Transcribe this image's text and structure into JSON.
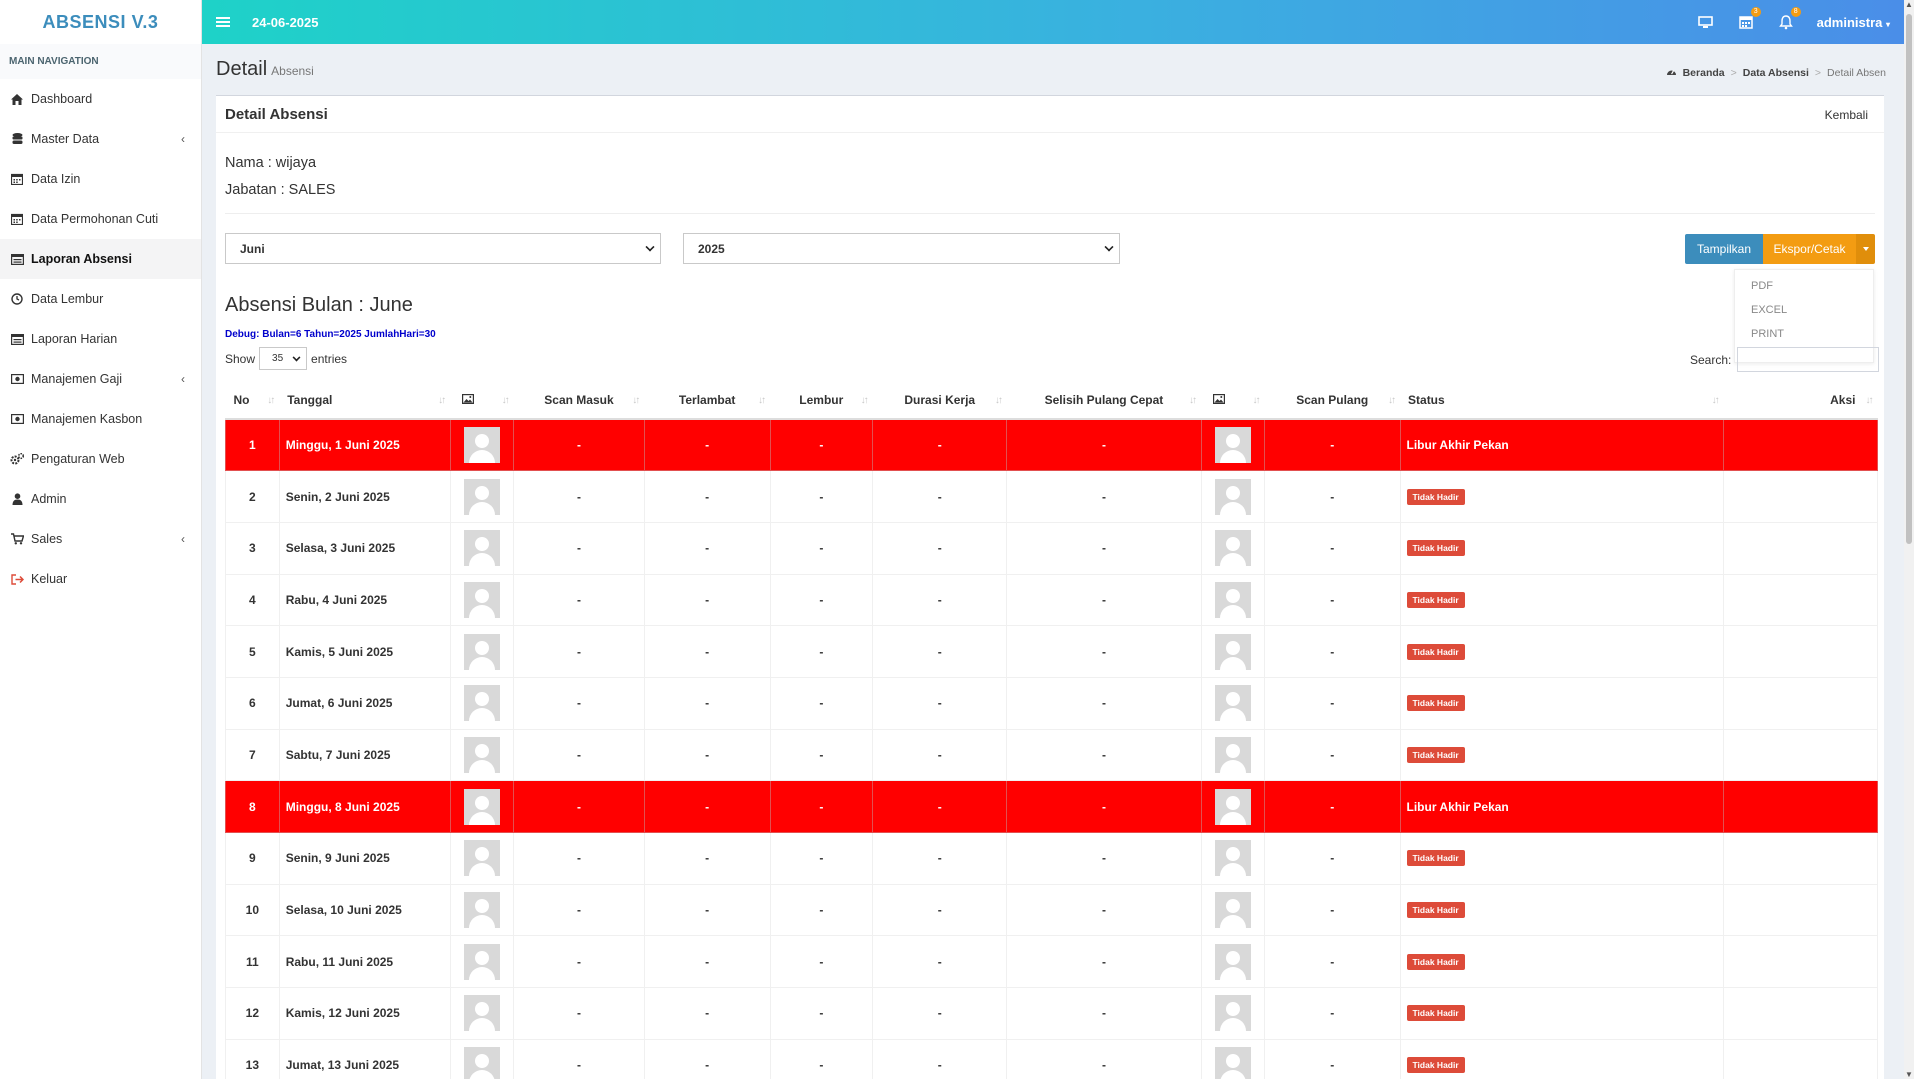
{
  "app": {
    "logo": "ABSENSI V.3"
  },
  "topbar": {
    "date": "24-06-2025",
    "user": "administra",
    "calendar_badge": "3",
    "bell_badge": "8"
  },
  "sidebar": {
    "header": "MAIN NAVIGATION",
    "items": [
      {
        "label": "Dashboard",
        "icon": "home-icon",
        "chevron": false,
        "active": false
      },
      {
        "label": "Master Data",
        "icon": "database-icon",
        "chevron": true,
        "active": false
      },
      {
        "label": "Data Izin",
        "icon": "calendar-icon",
        "chevron": false,
        "active": false
      },
      {
        "label": "Data Permohonan Cuti",
        "icon": "calendar-icon",
        "chevron": false,
        "active": false
      },
      {
        "label": "Laporan Absensi",
        "icon": "report-icon",
        "chevron": false,
        "active": true
      },
      {
        "label": "Data Lembur",
        "icon": "clock-icon",
        "chevron": false,
        "active": false
      },
      {
        "label": "Laporan Harian",
        "icon": "report-icon",
        "chevron": false,
        "active": false
      },
      {
        "label": "Manajemen Gaji",
        "icon": "money-icon",
        "chevron": true,
        "active": false
      },
      {
        "label": "Manajemen Kasbon",
        "icon": "money-icon",
        "chevron": false,
        "active": false
      },
      {
        "label": "Pengaturan Web",
        "icon": "cogs-icon",
        "chevron": false,
        "active": false
      },
      {
        "label": "Admin",
        "icon": "user-icon",
        "chevron": false,
        "active": false
      },
      {
        "label": "Sales",
        "icon": "cart-icon",
        "chevron": true,
        "active": false
      },
      {
        "label": "Keluar",
        "icon": "sign-out-icon",
        "chevron": false,
        "active": false
      }
    ]
  },
  "page": {
    "title": "Detail",
    "subtitle": "Absensi",
    "breadcrumb": [
      "Beranda",
      "Data Absensi",
      "Detail Absen"
    ]
  },
  "box": {
    "title": "Detail Absensi",
    "back": "Kembali",
    "nama": "Nama : wijaya",
    "jabatan": "Jabatan : SALES"
  },
  "filters": {
    "month": "Juni",
    "year": "2025"
  },
  "buttons": {
    "show": "Tampilkan",
    "export": "Ekspor/Cetak"
  },
  "export_menu": [
    "PDF",
    "EXCEL",
    "PRINT"
  ],
  "section": {
    "title": "Absensi Bulan : June",
    "debug": "Debug: Bulan=6 Tahun=2025 JumlahHari=30"
  },
  "datatable": {
    "show_label": "Show",
    "entries_value": "35",
    "entries_label": "entries",
    "search_label": "Search:"
  },
  "columns": [
    "No",
    "Tanggal",
    "",
    "Scan Masuk",
    "Terlambat",
    "Lembur",
    "Durasi Kerja",
    "Selisih Pulang Cepat",
    "",
    "Scan Pulang",
    "Status",
    "Aksi"
  ],
  "rows": [
    {
      "no": "1",
      "date": "Minggu, 1 Juni 2025",
      "weekend": true,
      "status": "Libur Akhir Pekan"
    },
    {
      "no": "2",
      "date": "Senin, 2 Juni 2025",
      "weekend": false,
      "status": "Tidak Hadir"
    },
    {
      "no": "3",
      "date": "Selasa, 3 Juni 2025",
      "weekend": false,
      "status": "Tidak Hadir"
    },
    {
      "no": "4",
      "date": "Rabu, 4 Juni 2025",
      "weekend": false,
      "status": "Tidak Hadir"
    },
    {
      "no": "5",
      "date": "Kamis, 5 Juni 2025",
      "weekend": false,
      "status": "Tidak Hadir"
    },
    {
      "no": "6",
      "date": "Jumat, 6 Juni 2025",
      "weekend": false,
      "status": "Tidak Hadir"
    },
    {
      "no": "7",
      "date": "Sabtu, 7 Juni 2025",
      "weekend": false,
      "status": "Tidak Hadir"
    },
    {
      "no": "8",
      "date": "Minggu, 8 Juni 2025",
      "weekend": true,
      "status": "Libur Akhir Pekan"
    },
    {
      "no": "9",
      "date": "Senin, 9 Juni 2025",
      "weekend": false,
      "status": "Tidak Hadir"
    },
    {
      "no": "10",
      "date": "Selasa, 10 Juni 2025",
      "weekend": false,
      "status": "Tidak Hadir"
    },
    {
      "no": "11",
      "date": "Rabu, 11 Juni 2025",
      "weekend": false,
      "status": "Tidak Hadir"
    },
    {
      "no": "12",
      "date": "Kamis, 12 Juni 2025",
      "weekend": false,
      "status": "Tidak Hadir"
    },
    {
      "no": "13",
      "date": "Jumat, 13 Juni 2025",
      "weekend": false,
      "status": "Tidak Hadir"
    }
  ],
  "cell_placeholder": "-",
  "colors": {
    "weekend_row": "#ff0000",
    "absent_label": "#dd4b39",
    "primary": "#3c8dbc",
    "warning": "#f39c12"
  }
}
